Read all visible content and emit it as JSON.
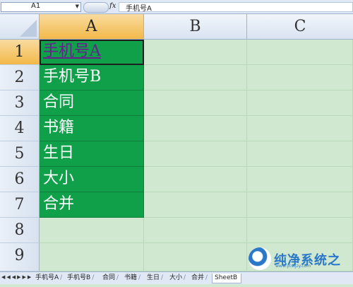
{
  "formula_bar": {
    "name_box": "A1",
    "fx_label": "fx",
    "content": "手机号A"
  },
  "columns": [
    "A",
    "B",
    "C"
  ],
  "rows": [
    "1",
    "2",
    "3",
    "4",
    "5",
    "6",
    "7",
    "8",
    "9"
  ],
  "cells_a": [
    "手机号A",
    "手机号B",
    "合同",
    "书籍",
    "生日",
    "大小",
    "合并"
  ],
  "fill_color": "#10a04a",
  "sheet_tabs": [
    "手机号A",
    "手机号B",
    "合同",
    "书籍",
    "生日",
    "大小",
    "合并",
    "SheetB"
  ],
  "watermark": {
    "text": "纯净系统之家",
    "url": "www.ycwjzy.com"
  }
}
